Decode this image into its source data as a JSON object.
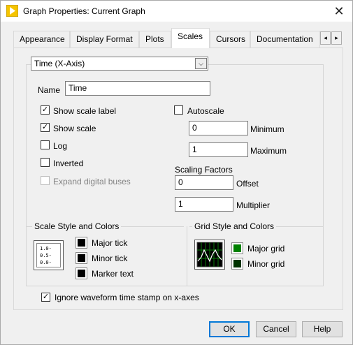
{
  "window": {
    "title": "Graph Properties: Current Graph",
    "close_glyph": "✕"
  },
  "tabs": [
    {
      "label": "Appearance"
    },
    {
      "label": "Display Format"
    },
    {
      "label": "Plots"
    },
    {
      "label": "Scales"
    },
    {
      "label": "Cursors"
    },
    {
      "label": "Documentation"
    }
  ],
  "tab_scroll": {
    "left": "◂",
    "right": "▸"
  },
  "axis_select": {
    "value": "Time (X-Axis)",
    "arrow": "⌵"
  },
  "name": {
    "label": "Name",
    "value": "Time"
  },
  "options": {
    "show_scale_label": {
      "label": "Show scale label",
      "checked": true
    },
    "show_scale": {
      "label": "Show scale",
      "checked": true
    },
    "log": {
      "label": "Log",
      "checked": false
    },
    "inverted": {
      "label": "Inverted",
      "checked": false
    },
    "expand_digital_buses": {
      "label": "Expand digital buses",
      "checked": false,
      "disabled": true
    },
    "autoscale": {
      "label": "Autoscale",
      "checked": false
    }
  },
  "range": {
    "minimum": {
      "label": "Minimum",
      "value": "0"
    },
    "maximum": {
      "label": "Maximum",
      "value": "1"
    }
  },
  "scaling": {
    "title": "Scaling Factors",
    "offset": {
      "label": "Offset",
      "value": "0"
    },
    "multiplier": {
      "label": "Multiplier",
      "value": "1"
    }
  },
  "scale_style": {
    "title": "Scale Style and Colors",
    "icon_ticks": [
      "1.0-",
      "0.5-",
      "0.0-"
    ],
    "major_tick": {
      "label": "Major tick",
      "color": "#000000"
    },
    "minor_tick": {
      "label": "Minor tick",
      "color": "#000000"
    },
    "marker_text": {
      "label": "Marker text",
      "color": "#000000"
    }
  },
  "grid_style": {
    "title": "Grid Style and Colors",
    "major_grid": {
      "label": "Major grid",
      "color": "#008000"
    },
    "minor_grid": {
      "label": "Minor grid",
      "color": "#003300"
    }
  },
  "ignore_timestamp": {
    "label": "Ignore waveform time stamp on x-axes",
    "checked": true
  },
  "buttons": {
    "ok": "OK",
    "cancel": "Cancel",
    "help": "Help"
  },
  "check_glyph": "✓"
}
